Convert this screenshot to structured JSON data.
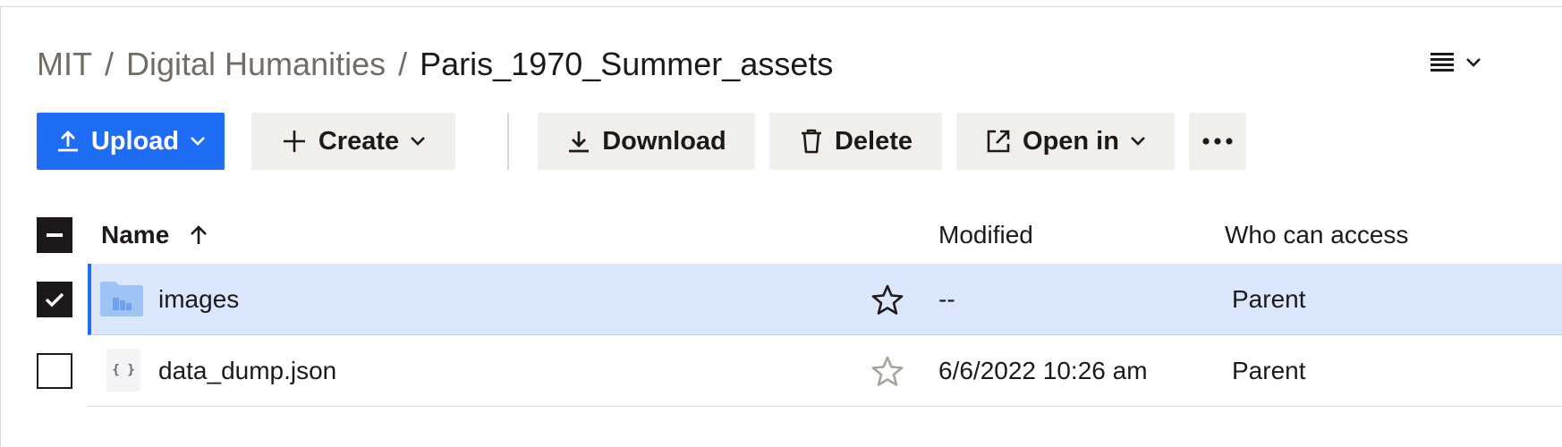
{
  "breadcrumb": {
    "items": [
      "MIT",
      "Digital Humanities"
    ],
    "separator": "/",
    "current": "Paris_1970_Summer_assets"
  },
  "view_toggle": {
    "icon": "list-view-icon"
  },
  "toolbar": {
    "upload": "Upload",
    "create": "Create",
    "download": "Download",
    "delete": "Delete",
    "open_in": "Open in",
    "more_icon": "more-horizontal-icon"
  },
  "table": {
    "columns": {
      "name": "Name",
      "modified": "Modified",
      "access": "Who can access"
    },
    "sort": "ascending",
    "rows": [
      {
        "name": "images",
        "type": "folder",
        "modified": "--",
        "access": "Parent",
        "selected": true,
        "starred": false
      },
      {
        "name": "data_dump.json",
        "type": "json",
        "icon_label": "{ }",
        "modified": "6/6/2022 10:26 am",
        "access": "Parent",
        "selected": false,
        "starred": false
      }
    ]
  },
  "colors": {
    "accent": "#1f6cf5",
    "selected_row": "#dbe7fc",
    "button_bg": "#f1efec",
    "text": "#1e1919",
    "muted_text": "#736c64"
  }
}
